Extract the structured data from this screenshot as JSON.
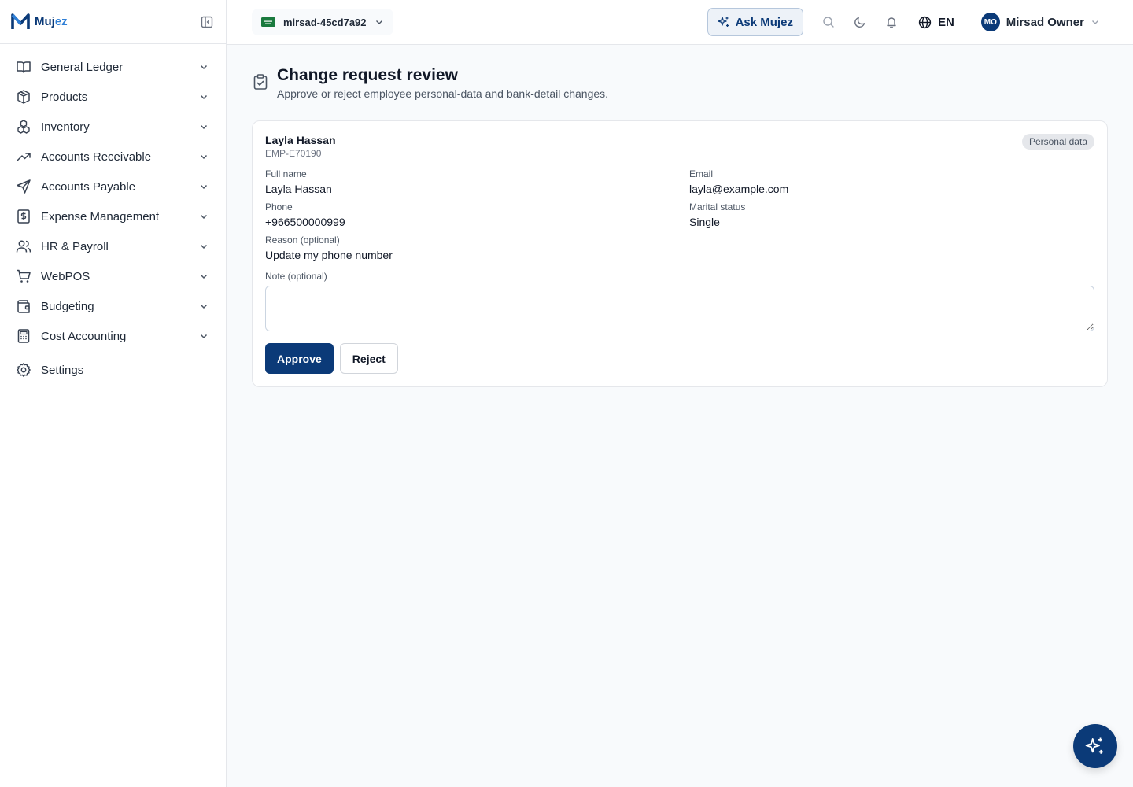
{
  "app": {
    "logo_prefix": "M",
    "logo_main": "Muj",
    "logo_accent": "ez"
  },
  "colors": {
    "brand": "#0b3a78",
    "accent": "#2f7fd6",
    "badge_bg": "#e5e7eb",
    "flag": "#1a7a3e"
  },
  "sidebar": {
    "items": [
      {
        "label": "General Ledger",
        "icon": "book-open-icon"
      },
      {
        "label": "Products",
        "icon": "package-icon"
      },
      {
        "label": "Inventory",
        "icon": "boxes-icon"
      },
      {
        "label": "Accounts Receivable",
        "icon": "trending-up-icon"
      },
      {
        "label": "Accounts Payable",
        "icon": "send-icon"
      },
      {
        "label": "Expense Management",
        "icon": "receipt-dollar-icon"
      },
      {
        "label": "HR & Payroll",
        "icon": "users-icon"
      },
      {
        "label": "WebPOS",
        "icon": "shopping-cart-icon"
      },
      {
        "label": "Budgeting",
        "icon": "wallet-icon"
      },
      {
        "label": "Cost Accounting",
        "icon": "calculator-icon"
      }
    ],
    "settings_label": "Settings"
  },
  "topbar": {
    "org_name": "mirsad-45cd7a92",
    "ask_label": "Ask Mujez",
    "language": "EN",
    "user_initials": "MO",
    "user_name": "Mirsad Owner"
  },
  "page": {
    "title": "Change request review",
    "subtitle": "Approve or reject employee personal-data and bank-detail changes."
  },
  "request": {
    "employee_name": "Layla Hassan",
    "employee_id": "EMP-E70190",
    "type_badge": "Personal data",
    "fields": {
      "full_name_label": "Full name",
      "full_name": "Layla Hassan",
      "email_label": "Email",
      "email": "layla@example.com",
      "phone_label": "Phone",
      "phone": "+966500000999",
      "marital_label": "Marital status",
      "marital": "Single",
      "reason_label": "Reason (optional)",
      "reason": "Update my phone number"
    },
    "note_label": "Note (optional)",
    "note_value": "",
    "approve_label": "Approve",
    "reject_label": "Reject"
  }
}
